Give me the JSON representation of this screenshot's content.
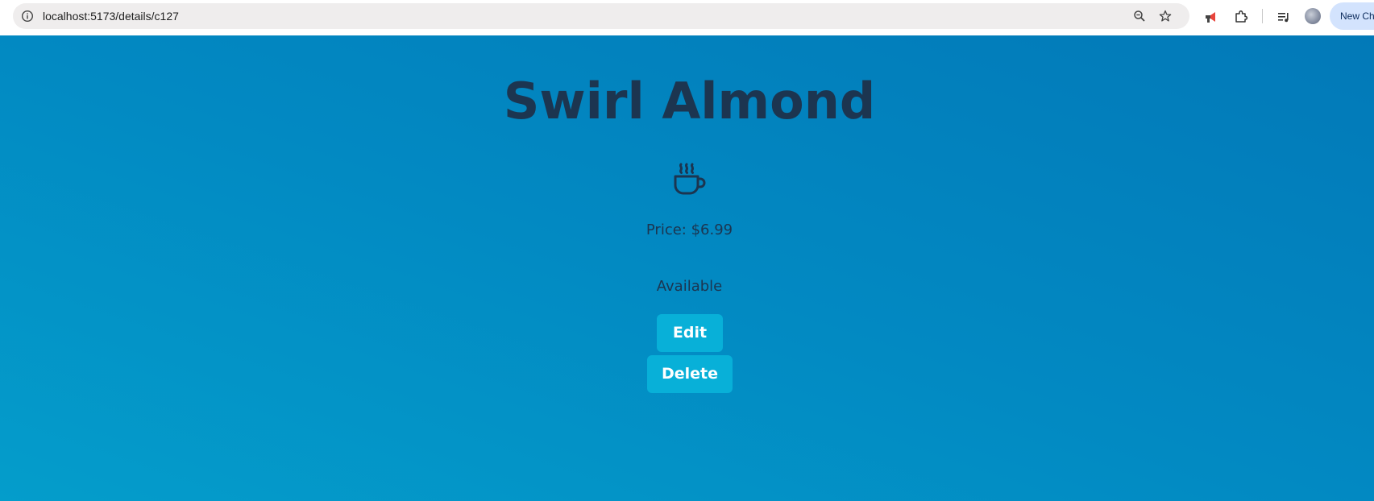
{
  "browser": {
    "url": "localhost:5173/details/c127",
    "new_chrome_label": "New Ch",
    "icons": {
      "info": "info-icon",
      "zoom": "zoom-icon",
      "bookmark": "star-icon",
      "extension_promo": "megaphone-icon",
      "extensions": "puzzle-icon",
      "media": "media-queue-icon",
      "profile": "avatar"
    }
  },
  "product": {
    "name": "Swirl Almond",
    "icon": "coffee-cup-icon",
    "price_text": "Price: $6.99",
    "availability": "Available"
  },
  "actions": {
    "edit_label": "Edit",
    "delete_label": "Delete"
  },
  "colors": {
    "background_top": "#0279b8",
    "background_bottom": "#049dcb",
    "text": "#1c3550",
    "button": "#08b0d8",
    "button_text": "#ffffff"
  }
}
